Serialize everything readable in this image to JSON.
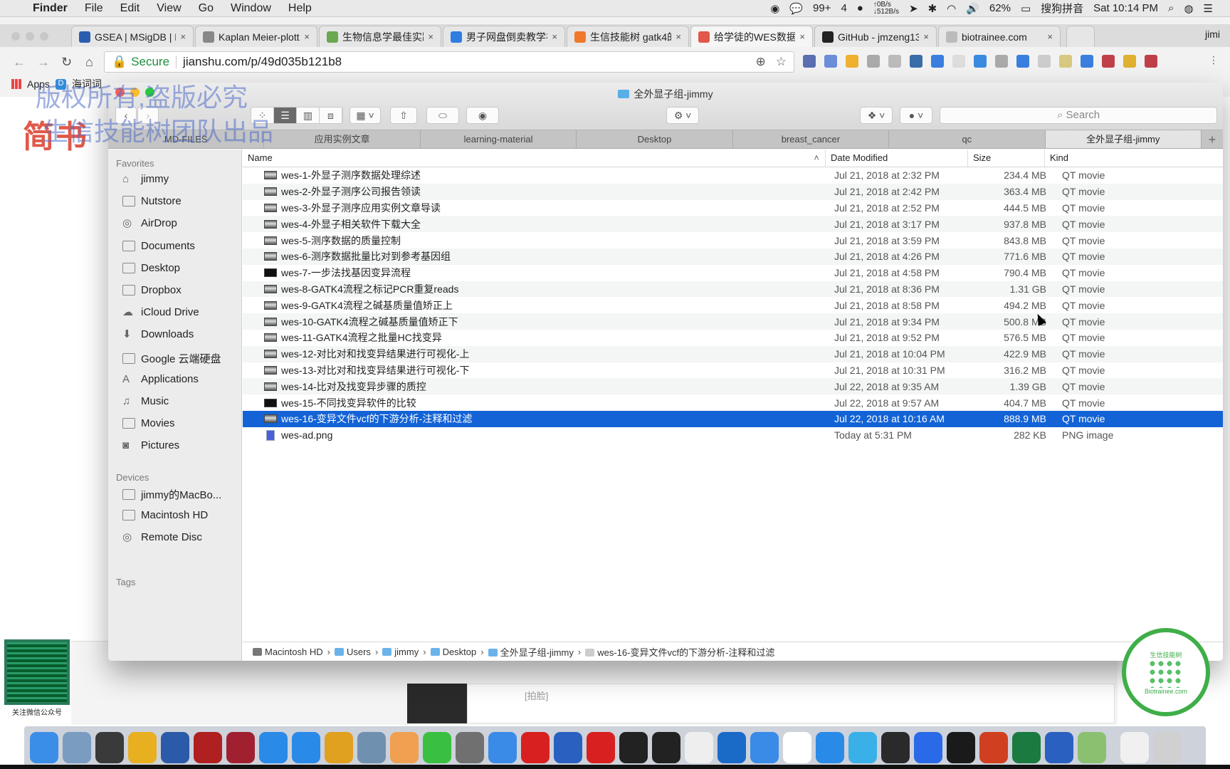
{
  "menubar": {
    "app": "Finder",
    "items": [
      "File",
      "Edit",
      "View",
      "Go",
      "Window",
      "Help"
    ],
    "status": {
      "wechat_count": "99+",
      "notif": "4",
      "net_up": "↑0B/s",
      "net_down": "↓512B/s",
      "battery": "62%",
      "ime": "搜狗拼音",
      "clock": "Sat 10:14 PM"
    }
  },
  "browser": {
    "tabs": [
      {
        "title": "GSEA | MSigDB | M",
        "color": "#2a5db0"
      },
      {
        "title": "Kaplan Meier-plott",
        "color": "#888888"
      },
      {
        "title": "生物信息学最佳实践",
        "color": "#6aa84f"
      },
      {
        "title": "男子网盘倒卖教学视",
        "color": "#2f7de1"
      },
      {
        "title": "生信技能树 gatk4的",
        "color": "#f0782b"
      },
      {
        "title": "给学徒的WES数据分",
        "color": "#e0594a"
      },
      {
        "title": "GitHub - jmzeng13",
        "color": "#222222"
      },
      {
        "title": "biotrainee.com",
        "color": "#bbbbbb"
      }
    ],
    "active_tab": 5,
    "profile": "jimi",
    "secure_label": "Secure",
    "url": "jianshu.com/p/49d035b121b8",
    "bookmarks": [
      "Apps",
      "海词词"
    ],
    "extension_colors": [
      "#5a6fb0",
      "#6a8ed8",
      "#f0b030",
      "#aaaaaa",
      "#bbbbbb",
      "#3a6ea8",
      "#3a7fe0",
      "#dddddd",
      "#3a8be0",
      "#aaaaaa",
      "#3a7fe0",
      "#cccccc",
      "#d8c880",
      "#3a7fe0",
      "#c0404a",
      "#e0b030",
      "#c0404a"
    ]
  },
  "page": {
    "logo_text": "简书",
    "card_text": "[拍脸]"
  },
  "watermarks": [
    "版权所有,盗版必究",
    "生信技能树团队出品"
  ],
  "finder": {
    "title": "全外显子组-jimmy",
    "search_placeholder": "Search",
    "tabs": [
      "MD-FILES",
      "应用实例文章",
      "learning-material",
      "Desktop",
      "breast_cancer",
      "qc",
      "全外显子组-jimmy"
    ],
    "active_tab": 6,
    "sidebar": {
      "favorites_label": "Favorites",
      "favorites": [
        "jimmy",
        "Nutstore",
        "AirDrop",
        "Documents",
        "Desktop",
        "Dropbox",
        "iCloud Drive",
        "Downloads",
        "Google 云端硬盘",
        "Applications",
        "Music",
        "Movies",
        "Pictures"
      ],
      "devices_label": "Devices",
      "devices": [
        "jimmy的MacBo...",
        "Macintosh HD",
        "Remote Disc"
      ],
      "tags_label": "Tags"
    },
    "columns": {
      "name": "Name",
      "date": "Date Modified",
      "size": "Size",
      "kind": "Kind"
    },
    "files": [
      {
        "name": "wes-1-外显子测序数据处理综述",
        "date": "Jul 21, 2018 at 2:32 PM",
        "size": "234.4 MB",
        "kind": "QT movie"
      },
      {
        "name": "wes-2-外显子测序公司报告领读",
        "date": "Jul 21, 2018 at 2:42 PM",
        "size": "363.4 MB",
        "kind": "QT movie"
      },
      {
        "name": "wes-3-外显子测序应用实例文章导读",
        "date": "Jul 21, 2018 at 2:52 PM",
        "size": "444.5 MB",
        "kind": "QT movie"
      },
      {
        "name": "wes-4-外显子相关软件下载大全",
        "date": "Jul 21, 2018 at 3:17 PM",
        "size": "937.8 MB",
        "kind": "QT movie"
      },
      {
        "name": "wes-5-测序数据的质量控制",
        "date": "Jul 21, 2018 at 3:59 PM",
        "size": "843.8 MB",
        "kind": "QT movie"
      },
      {
        "name": "wes-6-测序数据批量比对到参考基因组",
        "date": "Jul 21, 2018 at 4:26 PM",
        "size": "771.6 MB",
        "kind": "QT movie"
      },
      {
        "name": "wes-7-一步法找基因变异流程",
        "date": "Jul 21, 2018 at 4:58 PM",
        "size": "790.4 MB",
        "kind": "QT movie"
      },
      {
        "name": "wes-8-GATK4流程之标记PCR重复reads",
        "date": "Jul 21, 2018 at 8:36 PM",
        "size": "1.31 GB",
        "kind": "QT movie"
      },
      {
        "name": "wes-9-GATK4流程之碱基质量值矫正上",
        "date": "Jul 21, 2018 at 8:58 PM",
        "size": "494.2 MB",
        "kind": "QT movie"
      },
      {
        "name": "wes-10-GATK4流程之碱基质量值矫正下",
        "date": "Jul 21, 2018 at 9:34 PM",
        "size": "500.8 MB",
        "kind": "QT movie"
      },
      {
        "name": "wes-11-GATK4流程之批量HC找变异",
        "date": "Jul 21, 2018 at 9:52 PM",
        "size": "576.5 MB",
        "kind": "QT movie"
      },
      {
        "name": "wes-12-对比对和找变异结果进行可视化-上",
        "date": "Jul 21, 2018 at 10:04 PM",
        "size": "422.9 MB",
        "kind": "QT movie"
      },
      {
        "name": "wes-13-对比对和找变异结果进行可视化-下",
        "date": "Jul 21, 2018 at 10:31 PM",
        "size": "316.2 MB",
        "kind": "QT movie"
      },
      {
        "name": "wes-14-比对及找变异步骤的质控",
        "date": "Jul 22, 2018 at 9:35 AM",
        "size": "1.39 GB",
        "kind": "QT movie"
      },
      {
        "name": "wes-15-不同找变异软件的比较",
        "date": "Jul 22, 2018 at 9:57 AM",
        "size": "404.7 MB",
        "kind": "QT movie"
      },
      {
        "name": "wes-16-变异文件vcf的下游分析-注释和过滤",
        "date": "Jul 22, 2018 at 10:16 AM",
        "size": "888.9 MB",
        "kind": "QT movie"
      },
      {
        "name": "wes-ad.png",
        "date": "Today at 5:31 PM",
        "size": "282 KB",
        "kind": "PNG image"
      }
    ],
    "selected_index": 15,
    "path": [
      "Macintosh HD",
      "Users",
      "jimmy",
      "Desktop",
      "全外显子组-jimmy",
      "wes-16-变异文件vcf的下游分析-注释和过滤"
    ]
  },
  "overlay": {
    "qr_caption": "关注微信公众号",
    "logo_text": "生信技能树",
    "logo_url_text": "Biotrainee.com"
  },
  "dock": {
    "apps": [
      {
        "name": "finder",
        "color": "#3a8ee8"
      },
      {
        "name": "preview",
        "color": "#7a9cc0"
      },
      {
        "name": "sublime-text",
        "color": "#3a3a3a"
      },
      {
        "name": "unknown-w",
        "color": "#e8b020"
      },
      {
        "name": "word",
        "color": "#2a5aa8"
      },
      {
        "name": "filezilla",
        "color": "#b02020"
      },
      {
        "name": "mindnode",
        "color": "#a02030"
      },
      {
        "name": "safari",
        "color": "#2a8ae8"
      },
      {
        "name": "app-store",
        "color": "#2a8ae8"
      },
      {
        "name": "chrome",
        "color": "#e0a020"
      },
      {
        "name": "mail-utility",
        "color": "#7090b0"
      },
      {
        "name": "photos",
        "color": "#f0a050"
      },
      {
        "name": "wechat",
        "color": "#3ac040"
      },
      {
        "name": "system-preferences",
        "color": "#707070"
      },
      {
        "name": "notes-blue",
        "color": "#3a8ae8"
      },
      {
        "name": "netease-mail",
        "color": "#d82020"
      },
      {
        "name": "r",
        "color": "#2a60c0"
      },
      {
        "name": "youdao",
        "color": "#d82020"
      },
      {
        "name": "terminal",
        "color": "#222222"
      },
      {
        "name": "iterm",
        "color": "#222222"
      },
      {
        "name": "typora",
        "color": "#eeeeee"
      },
      {
        "name": "outlook",
        "color": "#1a6ac8"
      },
      {
        "name": "sketch-blue",
        "color": "#3a8ae8"
      },
      {
        "name": "xmind",
        "color": "#ffffff"
      },
      {
        "name": "baidu-cloud",
        "color": "#2a8ae8"
      },
      {
        "name": "qq-chat",
        "color": "#3ab0e8"
      },
      {
        "name": "quicktime",
        "color": "#2a2a2a"
      },
      {
        "name": "baidu-netdisk",
        "color": "#2a6ae8"
      },
      {
        "name": "activity-monitor",
        "color": "#1a1a1a"
      },
      {
        "name": "powerpoint",
        "color": "#d04020"
      },
      {
        "name": "excel",
        "color": "#1a7a40"
      },
      {
        "name": "rstudio",
        "color": "#2a60c0"
      },
      {
        "name": "maps",
        "color": "#8ac070"
      },
      {
        "name": "documents-stack",
        "color": "#f0f0f0"
      },
      {
        "name": "trash",
        "color": "#d0d0d0"
      }
    ]
  }
}
